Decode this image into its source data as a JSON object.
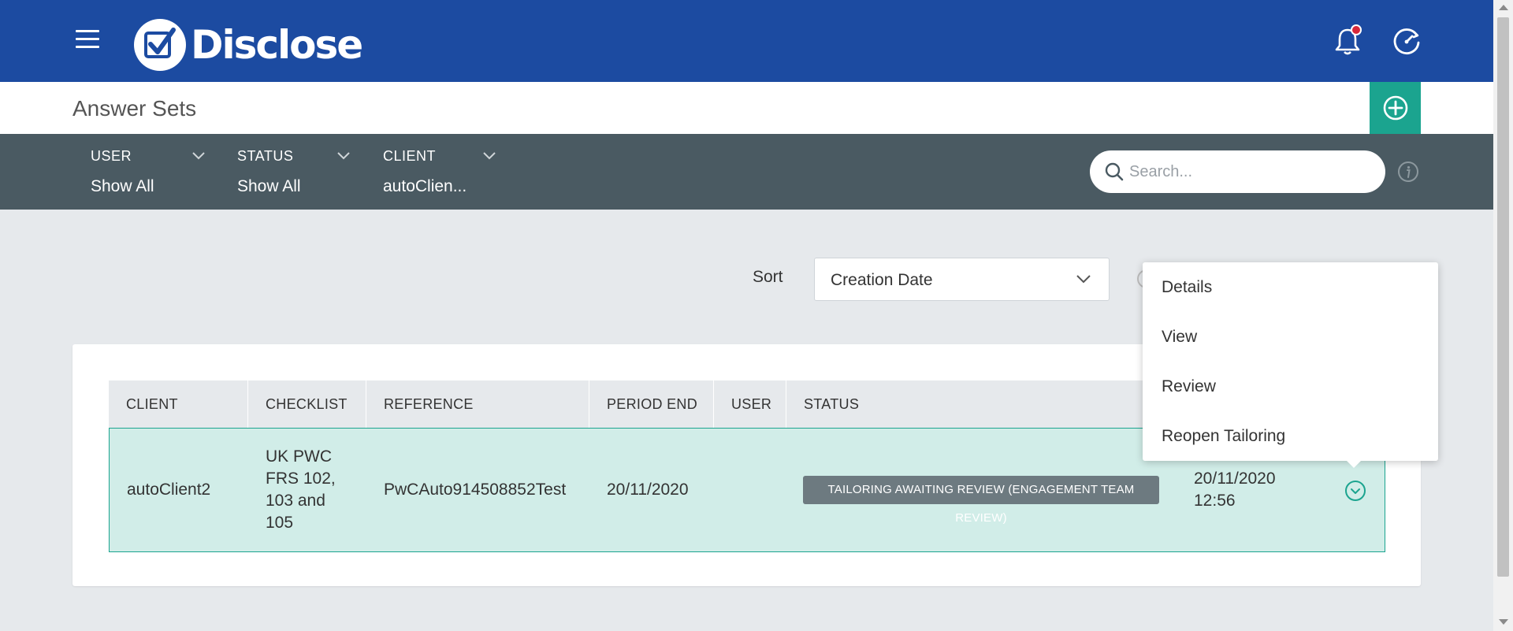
{
  "header": {
    "brand": "Disclose",
    "menu_icon": "hamburger-menu-icon",
    "notification_icon": "bell-icon",
    "dashboard_icon": "gauge-icon",
    "brand_color": "#1c4ba1"
  },
  "page": {
    "title": "Answer Sets",
    "add_icon": "plus-circle-icon",
    "accent_color": "#1ba48f"
  },
  "filters": [
    {
      "label": "USER",
      "value": "Show All"
    },
    {
      "label": "STATUS",
      "value": "Show All"
    },
    {
      "label": "CLIENT",
      "value": "autoClien..."
    }
  ],
  "search": {
    "placeholder": "Search...",
    "value": "",
    "icon": "search-icon",
    "info_icon": "info-icon"
  },
  "sort": {
    "label": "Sort",
    "selected": "Creation Date"
  },
  "table": {
    "columns": [
      "CLIENT",
      "CHECKLIST",
      "REFERENCE",
      "PERIOD END",
      "USER",
      "STATUS"
    ],
    "rows": [
      {
        "client": "autoClient2",
        "checklist": [
          "UK PWC",
          "FRS 102,",
          "103 and",
          "105"
        ],
        "reference": "PwCAuto914508852Test",
        "period_end": "20/11/2020",
        "user": "",
        "status": "TAILORING AWAITING REVIEW (ENGAGEMENT TEAM REVIEW)",
        "created": [
          "20/11/2020",
          "12:56"
        ],
        "status_color": "#6d7a80",
        "row_highlight": "#d1ede8"
      }
    ]
  },
  "menu": {
    "items": [
      "Details",
      "View",
      "Review",
      "Reopen Tailoring"
    ]
  }
}
